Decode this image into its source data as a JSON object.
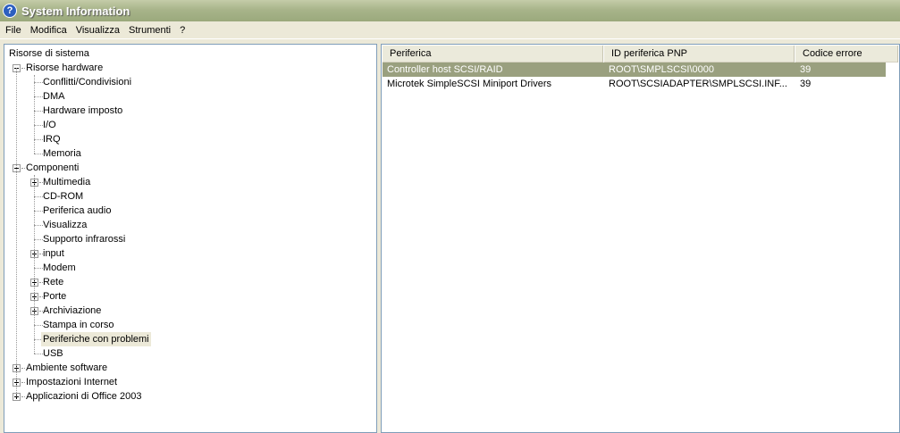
{
  "window": {
    "title": "System Information",
    "icon": "help-question-icon"
  },
  "menu": [
    "File",
    "Modifica",
    "Visualizza",
    "Strumenti",
    "?"
  ],
  "tree": [
    {
      "label": "Risorse di sistema",
      "level": 0,
      "expander": "none"
    },
    {
      "label": "Risorse hardware",
      "level": 1,
      "expander": "minus"
    },
    {
      "label": "Conflitti/Condivisioni",
      "level": 2,
      "expander": "none"
    },
    {
      "label": "DMA",
      "level": 2,
      "expander": "none"
    },
    {
      "label": "Hardware imposto",
      "level": 2,
      "expander": "none"
    },
    {
      "label": "I/O",
      "level": 2,
      "expander": "none"
    },
    {
      "label": "IRQ",
      "level": 2,
      "expander": "none"
    },
    {
      "label": "Memoria",
      "level": 2,
      "expander": "none"
    },
    {
      "label": "Componenti",
      "level": 1,
      "expander": "minus"
    },
    {
      "label": "Multimedia",
      "level": 2,
      "expander": "plus"
    },
    {
      "label": "CD-ROM",
      "level": 2,
      "expander": "none"
    },
    {
      "label": "Periferica audio",
      "level": 2,
      "expander": "none"
    },
    {
      "label": "Visualizza",
      "level": 2,
      "expander": "none"
    },
    {
      "label": "Supporto infrarossi",
      "level": 2,
      "expander": "none"
    },
    {
      "label": "input",
      "level": 2,
      "expander": "plus"
    },
    {
      "label": "Modem",
      "level": 2,
      "expander": "none"
    },
    {
      "label": "Rete",
      "level": 2,
      "expander": "plus"
    },
    {
      "label": "Porte",
      "level": 2,
      "expander": "plus"
    },
    {
      "label": "Archiviazione",
      "level": 2,
      "expander": "plus"
    },
    {
      "label": "Stampa in corso",
      "level": 2,
      "expander": "none"
    },
    {
      "label": "Periferiche con problemi",
      "level": 2,
      "expander": "none",
      "selected": true
    },
    {
      "label": "USB",
      "level": 2,
      "expander": "none"
    },
    {
      "label": "Ambiente software",
      "level": 1,
      "expander": "plus"
    },
    {
      "label": "Impostazioni Internet",
      "level": 1,
      "expander": "plus"
    },
    {
      "label": "Applicazioni di Office 2003",
      "level": 1,
      "expander": "plus"
    }
  ],
  "table": {
    "columns": [
      "Periferica",
      "ID periferica PNP",
      "Codice errore"
    ],
    "rows": [
      {
        "cells": [
          "Controller host SCSI/RAID",
          "ROOT\\SMPLSCSI\\0000",
          "39"
        ],
        "selected": true
      },
      {
        "cells": [
          "Microtek SimpleSCSI Miniport Drivers",
          "ROOT\\SCSIADAPTER\\SMPLSCSI.INF...",
          "39"
        ],
        "selected": false
      }
    ]
  },
  "colors": {
    "title_bar": "#a8b48a",
    "selection": "#9aa07f",
    "tree_selection": "#ece9d8"
  }
}
